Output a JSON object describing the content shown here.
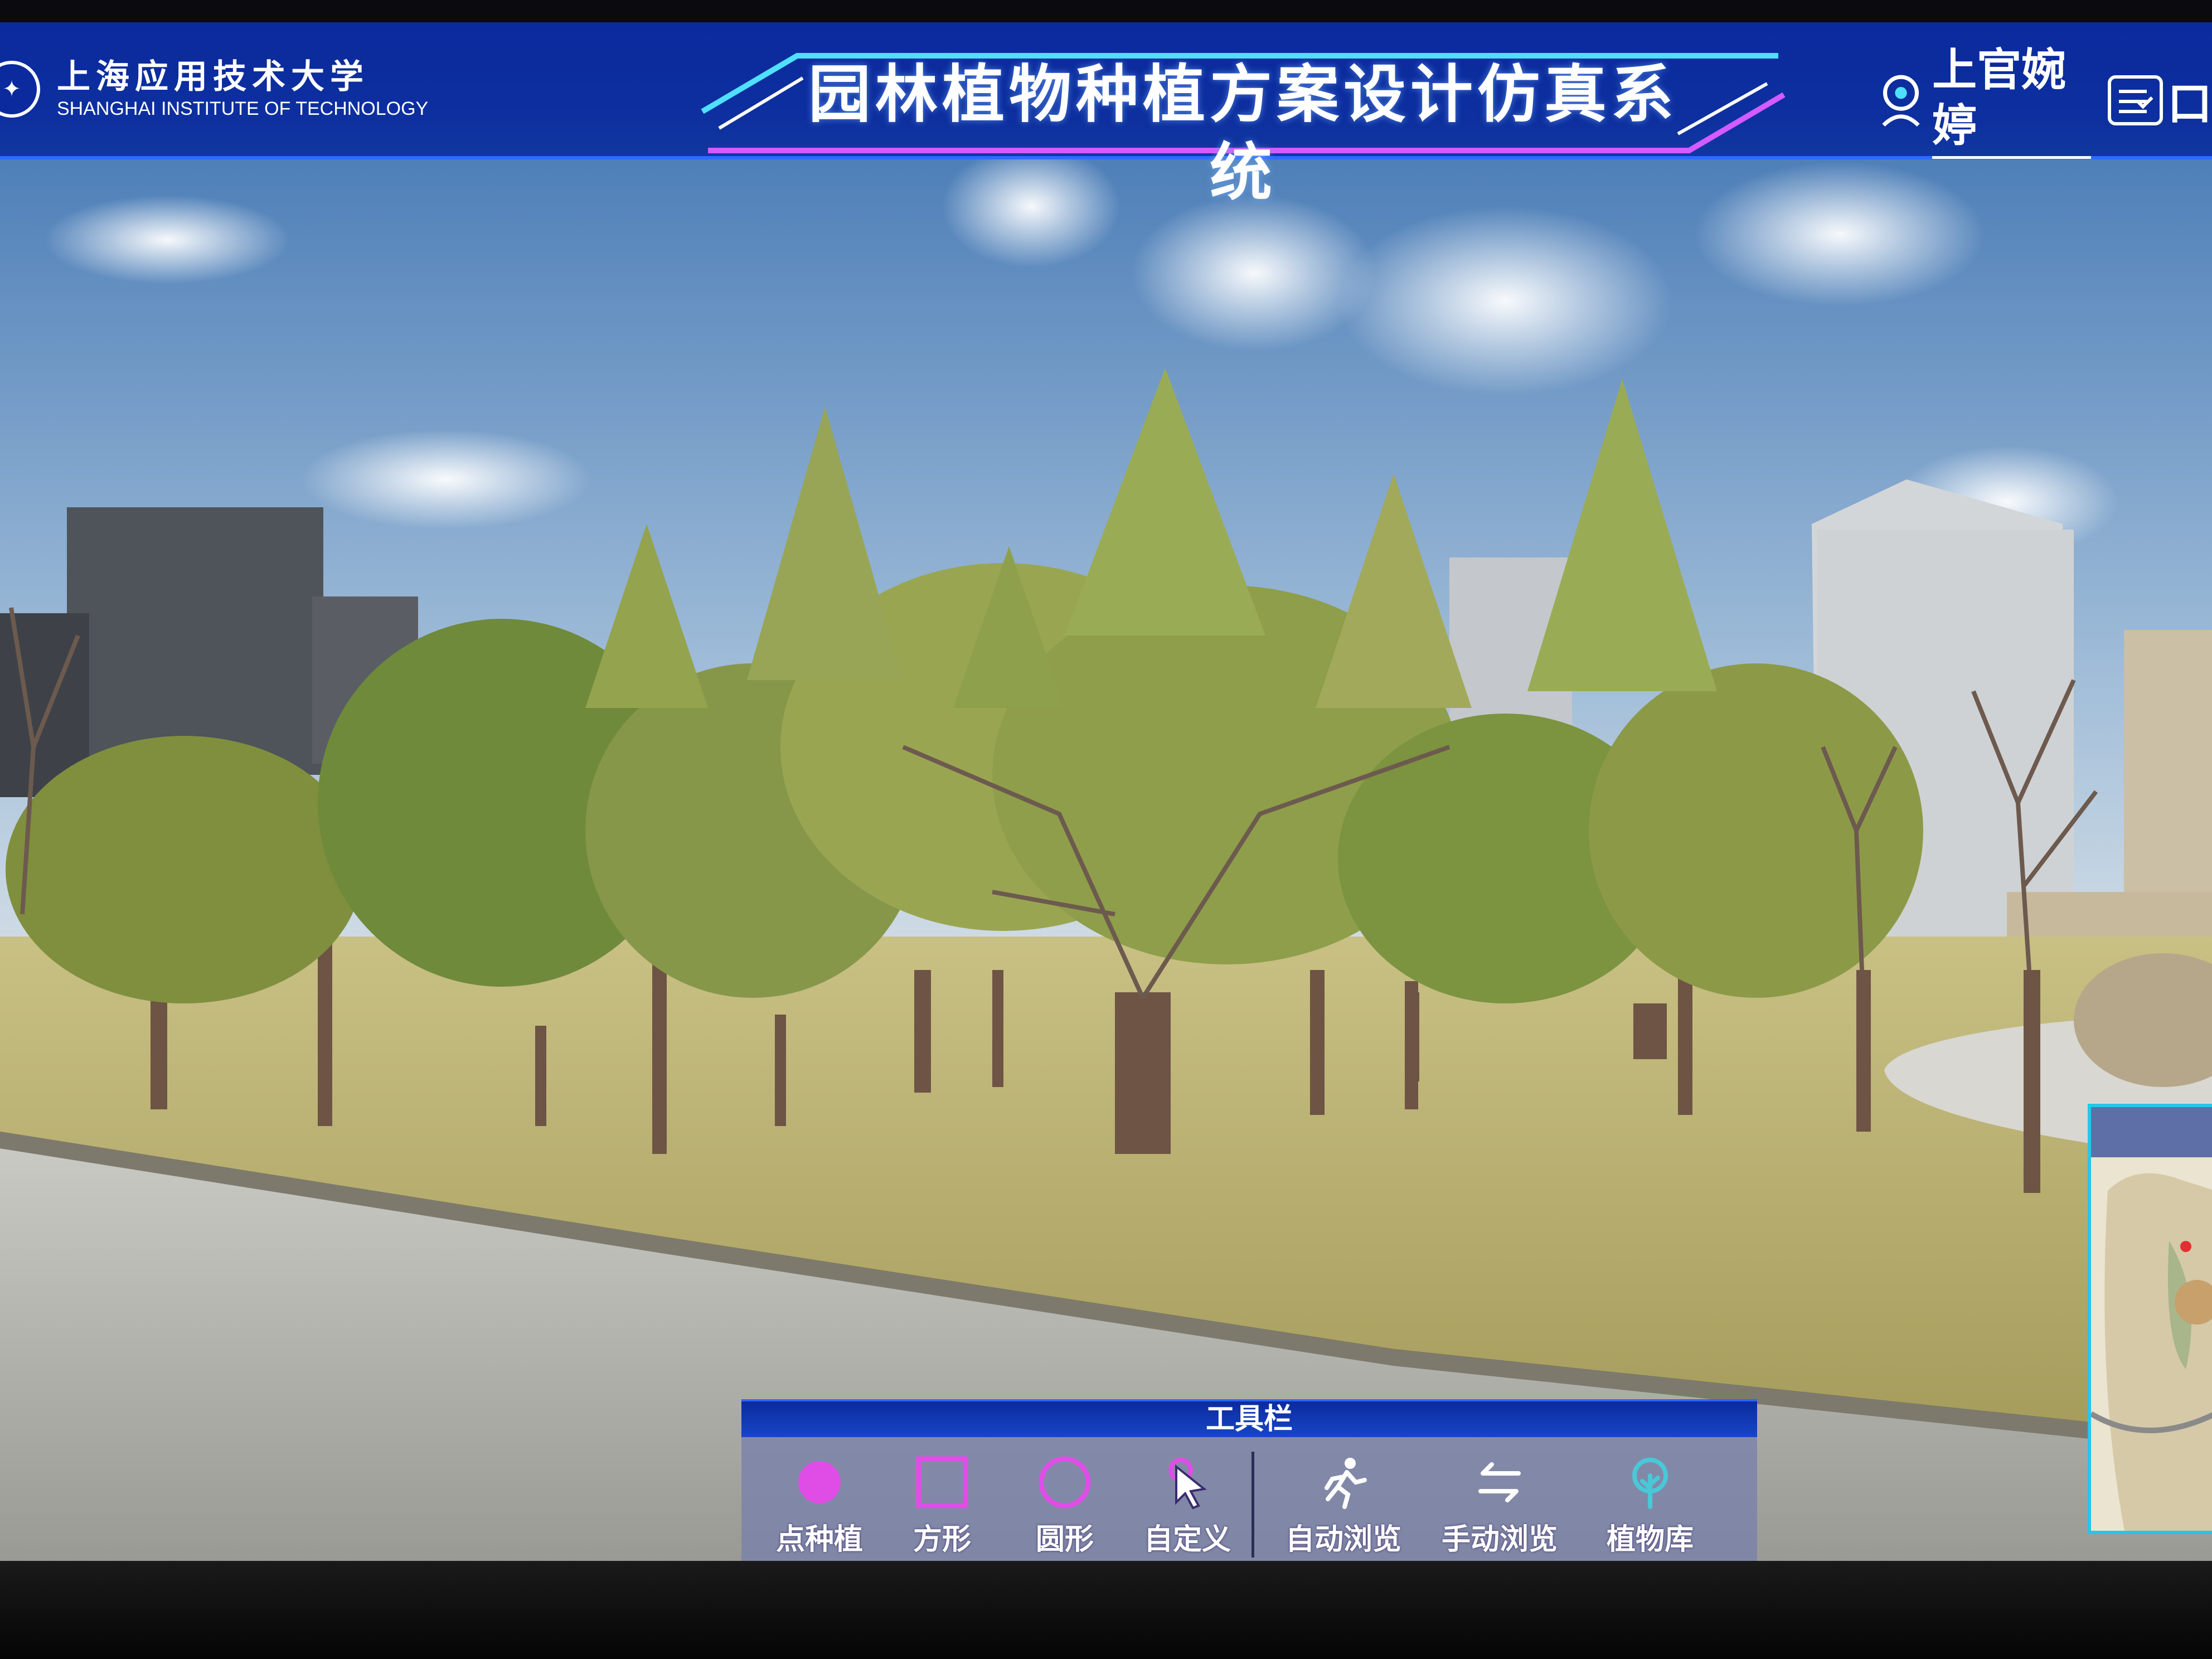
{
  "header": {
    "logo_cn": "上海应用技术大学",
    "logo_en": "SHANGHAI INSTITUTE OF TECHNOLOGY",
    "title": "园林植物种植方案设计仿真系统",
    "user_name": "上官婉婷",
    "cut_text": "口"
  },
  "toolbar": {
    "title": "工具栏",
    "tools": [
      {
        "label": "点种植",
        "icon": "filled-circle-icon"
      },
      {
        "label": "方形",
        "icon": "square-icon"
      },
      {
        "label": "圆形",
        "icon": "circle-icon"
      },
      {
        "label": "自定义",
        "icon": "cursor-icon"
      },
      {
        "label": "自动浏览",
        "icon": "running-person-icon"
      },
      {
        "label": "手动浏览",
        "icon": "swap-arrows-icon"
      },
      {
        "label": "植物库",
        "icon": "tree-icon"
      }
    ]
  },
  "colors": {
    "header_blue": "#0b2a9e",
    "accent_cyan": "#27c6e8",
    "tool_magenta": "#e04de6",
    "tool_cyan": "#49c8d8"
  }
}
